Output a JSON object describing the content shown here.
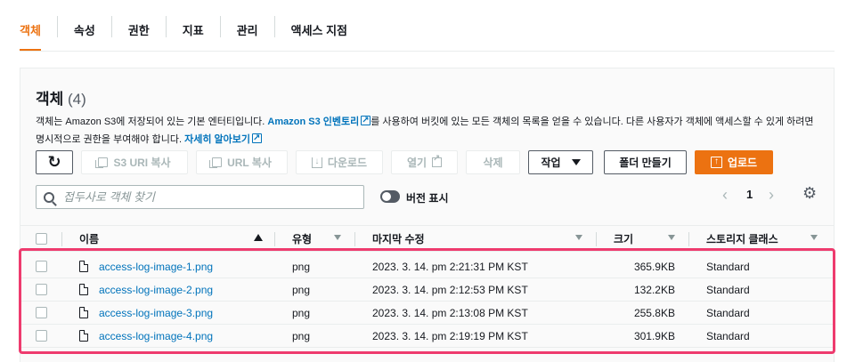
{
  "tabs": [
    {
      "label": "객체",
      "active": true
    },
    {
      "label": "속성",
      "active": false
    },
    {
      "label": "권한",
      "active": false
    },
    {
      "label": "지표",
      "active": false
    },
    {
      "label": "관리",
      "active": false
    },
    {
      "label": "액세스 지점",
      "active": false
    }
  ],
  "panel": {
    "title": "객체",
    "count": "(4)",
    "desc_part1": "객체는 Amazon S3에 저장되어 있는 기본 엔터티입니다. ",
    "desc_link1": "Amazon S3 인벤토리",
    "desc_part2": "를 사용하여 버킷에 있는 모든 객체의 목록을 얻을 수 있습니다. 다른 사용자가 객체에 액세스할 수 있게 하려면 명시적으로 권한을 부여해야 합니다. ",
    "desc_link2": "자세히 알아보기"
  },
  "toolbar": {
    "s3_uri_copy": "S3 URI 복사",
    "url_copy": "URL 복사",
    "download": "다운로드",
    "open": "열기",
    "delete": "삭제",
    "actions": "작업",
    "create_folder": "폴더 만들기",
    "upload": "업로드"
  },
  "search": {
    "placeholder": "접두사로 객체 찾기"
  },
  "version_toggle": {
    "label": "버전 표시"
  },
  "pager": {
    "current": "1"
  },
  "table": {
    "columns": {
      "name": "이름",
      "type": "유형",
      "modified": "마지막 수정",
      "size": "크기",
      "storage": "스토리지 클래스"
    },
    "rows": [
      {
        "name": "access-log-image-1.png",
        "type": "png",
        "modified": "2023. 3. 14. pm 2:21:31 PM KST",
        "size": "365.9KB",
        "storage": "Standard"
      },
      {
        "name": "access-log-image-2.png",
        "type": "png",
        "modified": "2023. 3. 14. pm 2:12:53 PM KST",
        "size": "132.2KB",
        "storage": "Standard"
      },
      {
        "name": "access-log-image-3.png",
        "type": "png",
        "modified": "2023. 3. 14. pm 2:13:08 PM KST",
        "size": "255.8KB",
        "storage": "Standard"
      },
      {
        "name": "access-log-image-4.png",
        "type": "png",
        "modified": "2023. 3. 14. pm 2:19:19 PM KST",
        "size": "301.9KB",
        "storage": "Standard"
      }
    ]
  },
  "colors": {
    "accent": "#ec7211",
    "link": "#0073bb",
    "highlight": "#ee3b6e"
  }
}
